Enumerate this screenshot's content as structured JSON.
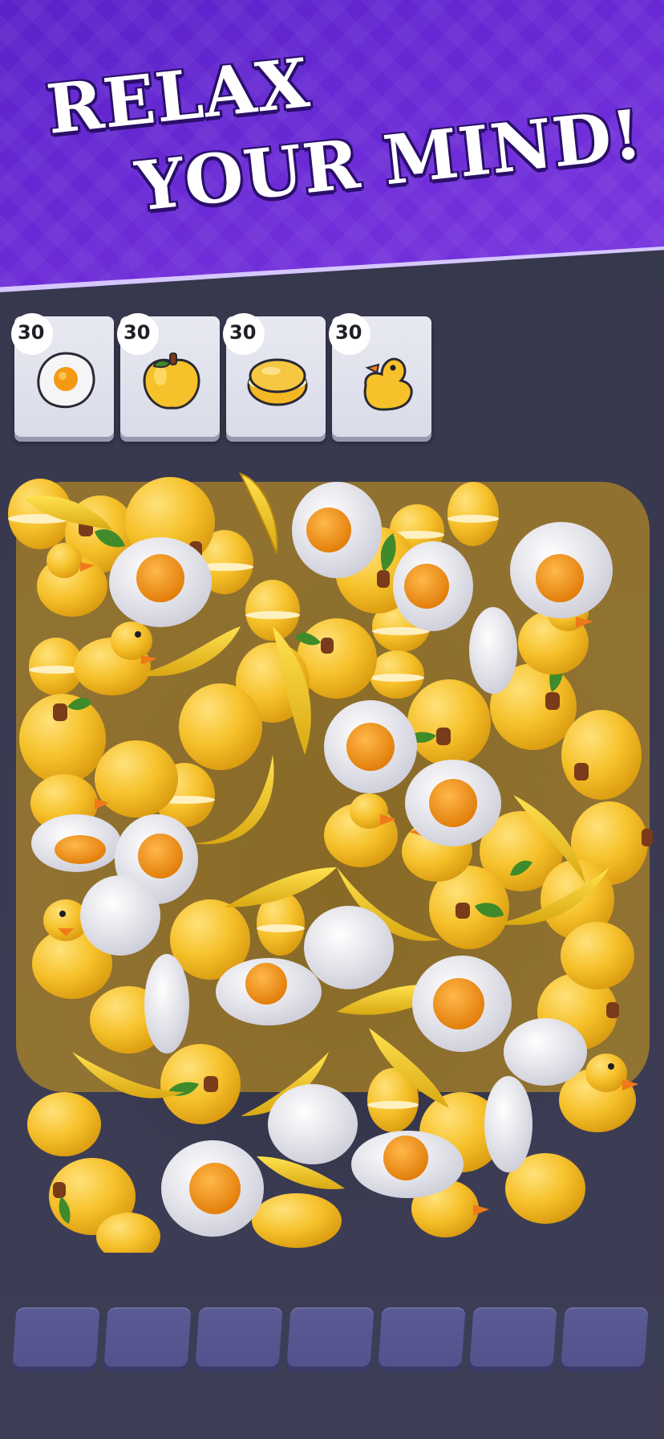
{
  "banner": {
    "line1": "RELAX",
    "line2": "YOUR MIND!"
  },
  "goals": [
    {
      "count": "30",
      "icon": "fried-egg-icon"
    },
    {
      "count": "30",
      "icon": "apple-icon"
    },
    {
      "count": "30",
      "icon": "macaron-icon"
    },
    {
      "count": "30",
      "icon": "rubber-duck-icon"
    }
  ],
  "tray": {
    "slots": 7
  },
  "colors": {
    "banner": "#6a2ad6",
    "background": "#3a3b52",
    "tray_slot": "#55558f",
    "item_yellow": "#f6c12a",
    "yolk": "#f08a0a",
    "egg_white": "#ececf2"
  }
}
